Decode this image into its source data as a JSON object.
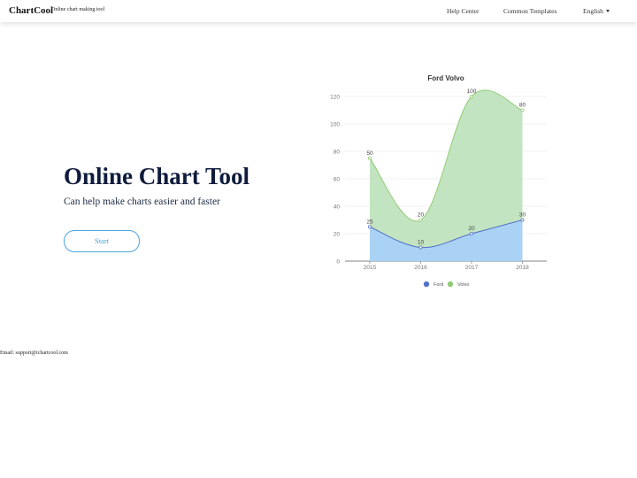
{
  "header": {
    "brand": "ChartCool",
    "tagline": "Online chart making tool",
    "nav": {
      "help": "Help Center",
      "templates": "Common Templates",
      "language": "English"
    }
  },
  "hero": {
    "title": "Online Chart Tool",
    "subtitle": "Can help make charts easier and faster",
    "start_label": "Start"
  },
  "footer": {
    "email": "Email: support@ichartcool.com"
  },
  "chart_data": {
    "type": "area",
    "title": "Ford Volvo",
    "categories": [
      "2015",
      "2016",
      "2017",
      "2018"
    ],
    "stacked": true,
    "series": [
      {
        "name": "Ford",
        "values": [
          25,
          10,
          20,
          30
        ],
        "color": "#5470c6",
        "fill": "#a9d2f5"
      },
      {
        "name": "Volvo",
        "values": [
          50,
          20,
          100,
          80
        ],
        "color": "#91cc75",
        "fill": "#c2e4c0"
      }
    ],
    "ylim": [
      0,
      120
    ],
    "yticks": [
      "0",
      "20",
      "40",
      "60",
      "80",
      "100",
      "120"
    ],
    "grid": true,
    "legend": "bottom"
  }
}
